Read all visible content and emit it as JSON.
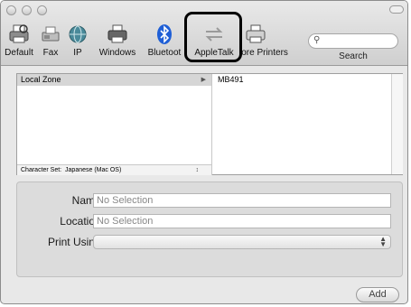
{
  "toolbar": {
    "items": [
      {
        "label": "Default",
        "icon": "default-printer-icon"
      },
      {
        "label": "Fax",
        "icon": "fax-icon"
      },
      {
        "label": "IP",
        "icon": "ip-globe-icon"
      },
      {
        "label": "Windows",
        "icon": "windows-printer-icon"
      },
      {
        "label": "Bluetoot",
        "icon": "bluetooth-icon"
      },
      {
        "label": "AppleTalk",
        "icon": "appletalk-icon"
      },
      {
        "label": "lore Printers",
        "icon": "more-printers-icon"
      }
    ],
    "search_label": "Search"
  },
  "browser": {
    "zones": [
      "Local Zone"
    ],
    "printers": [
      "MB491"
    ],
    "charset_label": "Character Set:",
    "charset_value": "Japanese (Mac OS)"
  },
  "form": {
    "name_label": "Name:",
    "name_value": "No Selection",
    "location_label": "Location:",
    "location_value": "No Selection",
    "print_using_label": "Print Using:",
    "print_using_value": ""
  },
  "footer": {
    "add_label": "Add"
  },
  "colors": {
    "bluetooth": "#1f5fd6",
    "highlight_border": "#000000"
  }
}
